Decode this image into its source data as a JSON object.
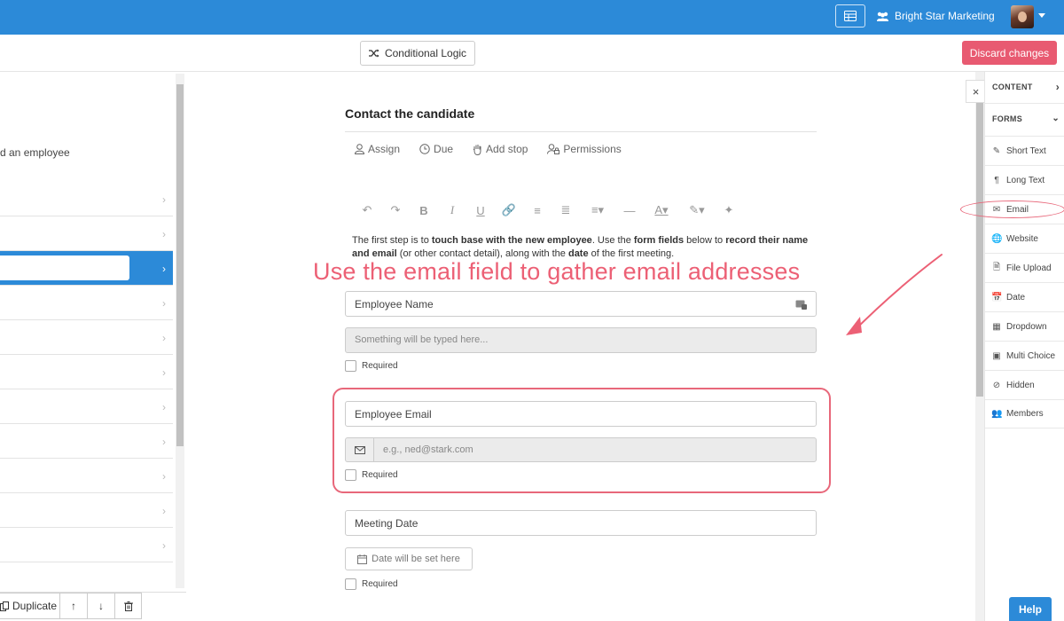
{
  "topbar": {
    "org_name": "Bright Star Marketing"
  },
  "subbar": {
    "conditional_logic": "Conditional Logic",
    "discard": "Discard changes"
  },
  "left": {
    "intro": "d an employee",
    "rows": [
      "",
      "",
      "",
      "",
      "",
      "",
      "",
      "",
      "",
      "",
      "",
      ""
    ],
    "duplicate": "Duplicate"
  },
  "step": {
    "title": "Contact the candidate",
    "actions": [
      "Assign",
      "Due",
      "Add stop",
      "Permissions"
    ],
    "description": {
      "p1": "The first step is to ",
      "b1": "touch base with the new employee",
      "p2": ". Use the ",
      "b2": "form fields",
      "p3": " below to ",
      "b3": "record their name and email",
      "p4": " (or other contact detail), along with the ",
      "b4": "date",
      "p5": " of the first meeting."
    },
    "annotation": "Use the email field to gather email addresses",
    "fields": [
      {
        "label": "Employee Name",
        "placeholder": "Something will be typed here...",
        "required": "Required"
      },
      {
        "label": "Employee Email",
        "placeholder": "e.g., ned@stark.com",
        "required": "Required"
      },
      {
        "label": "Meeting Date",
        "placeholder": "Date will be set here",
        "required": "Required"
      }
    ]
  },
  "right_panel": {
    "content_label": "CONTENT",
    "forms_label": "FORMS",
    "items": [
      {
        "label": "Short Text",
        "icon": "pencil-icon"
      },
      {
        "label": "Long Text",
        "icon": "paragraph-icon"
      },
      {
        "label": "Email",
        "icon": "envelope-icon"
      },
      {
        "label": "Website",
        "icon": "globe-icon"
      },
      {
        "label": "File Upload",
        "icon": "file-icon"
      },
      {
        "label": "Date",
        "icon": "calendar-icon"
      },
      {
        "label": "Dropdown",
        "icon": "dropdown-icon"
      },
      {
        "label": "Multi Choice",
        "icon": "multichoice-icon"
      },
      {
        "label": "Hidden",
        "icon": "eye-slash-icon"
      },
      {
        "label": "Members",
        "icon": "users-icon"
      }
    ]
  },
  "help": "Help",
  "colors": {
    "primary": "#2c8ad8",
    "danger": "#e85a71",
    "annotation": "#ec6075"
  }
}
